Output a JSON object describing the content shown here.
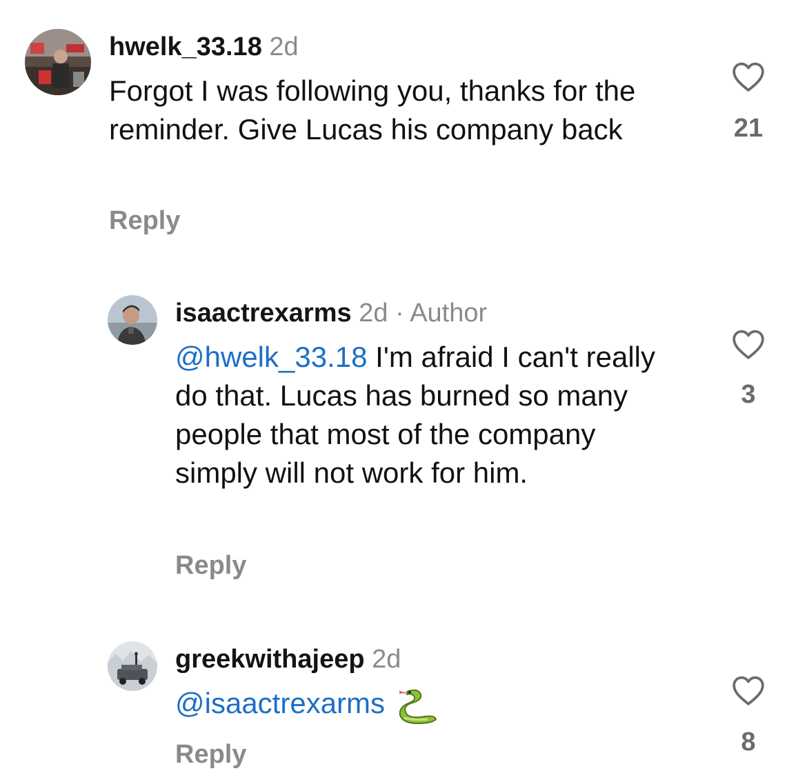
{
  "comments": [
    {
      "username": "hwelk_33.18",
      "time": "2d",
      "text": "Forgot I was following you, thanks for the reminder. Give Lucas his company back",
      "likes": "21",
      "reply_label": "Reply"
    },
    {
      "username": "isaactrexarms",
      "time": "2d",
      "separator": "·",
      "author_badge": "Author",
      "mention": "@hwelk_33.18",
      "text": " I'm afraid I can't really do that. Lucas has burned so many people that most of the company simply will not work for him.",
      "likes": "3",
      "reply_label": "Reply"
    },
    {
      "username": "greekwithajeep",
      "time": "2d",
      "mention": "@isaactrexarms",
      "emoji": "snake-emoji",
      "likes": "8",
      "reply_label": "Reply"
    }
  ],
  "icons": {
    "like": "heart-icon"
  },
  "colors": {
    "mention": "#1c6fc7",
    "muted": "#8a8a8a",
    "text": "#111111"
  }
}
